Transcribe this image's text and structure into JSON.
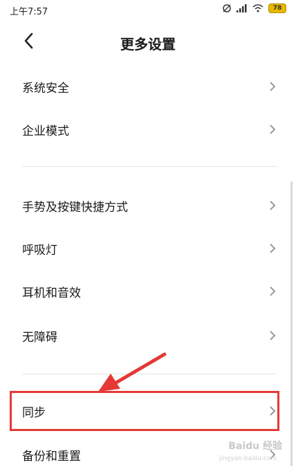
{
  "status_bar": {
    "time": "上午7:57",
    "battery": "78"
  },
  "header": {
    "title": "更多设置"
  },
  "menu": [
    {
      "label": "系统安全"
    },
    {
      "label": "企业模式"
    },
    {
      "label": "手势及按键快捷方式"
    },
    {
      "label": "呼吸灯"
    },
    {
      "label": "耳机和音效"
    },
    {
      "label": "无障碍"
    },
    {
      "label": "同步"
    },
    {
      "label": "备份和重置"
    }
  ],
  "annotation": {
    "highlight_color": "#e53935",
    "target": "同步"
  },
  "watermark": {
    "brand": "Baidu 经验",
    "url": "jingyan.baidu.com"
  },
  "icons": [
    "settings-sync-icon",
    "signal-icon",
    "wifi-icon",
    "battery-icon",
    "back-arrow-icon",
    "chevron-right-icon"
  ]
}
